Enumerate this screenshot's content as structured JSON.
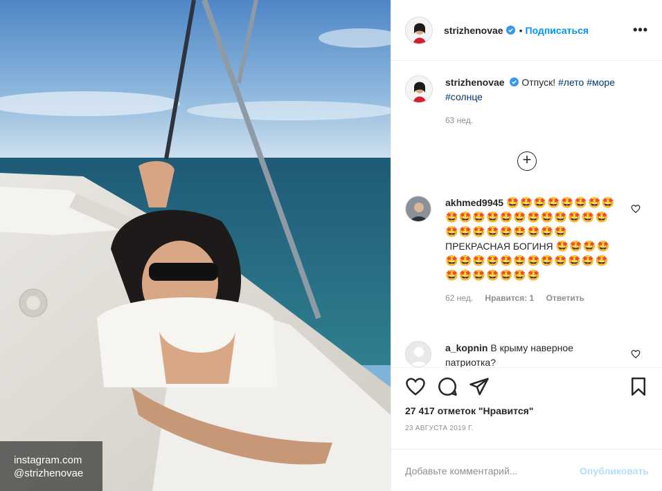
{
  "watermark": {
    "line1": "instagram.com",
    "line2": "@strizhenovae"
  },
  "header": {
    "username": "strizhenovae",
    "separator": "•",
    "follow_label": "Подписаться",
    "more_label": "•••"
  },
  "caption": {
    "username": "strizhenovae",
    "text": "Отпуск!",
    "tags": [
      "#лето",
      "#море",
      "#солнце"
    ],
    "time": "63 нед."
  },
  "load_more_label": "+",
  "comments": [
    {
      "username": "akhmed9945",
      "text_line1": "🤩🤩🤩🤩🤩🤩🤩🤩🤩🤩🤩🤩🤩🤩🤩🤩🤩🤩🤩🤩🤩🤩🤩🤩🤩🤩🤩🤩🤩",
      "text_middle": "ПРЕКРАСНАЯ БОГИНЯ",
      "text_line2": "🤩🤩🤩🤩🤩🤩🤩🤩🤩🤩🤩🤩🤩🤩🤩🤩🤩🤩🤩🤩🤩🤩🤩",
      "time": "62 нед.",
      "likes": "Нравится: 1",
      "reply": "Ответить"
    },
    {
      "username": "a_kopnin",
      "text": "В крыму наверное патриотка?"
    }
  ],
  "likes_text": "27 417 отметок \"Нравится\"",
  "date_text": "23 АВГУСТА 2019 Г.",
  "comment_placeholder": "Добавьте комментарий...",
  "publish_label": "Опубликовать",
  "colors": {
    "accent": "#0095f6",
    "publish_disabled": "#b2dffc",
    "verified": "#3897f0",
    "meta": "#8e8e8e"
  }
}
